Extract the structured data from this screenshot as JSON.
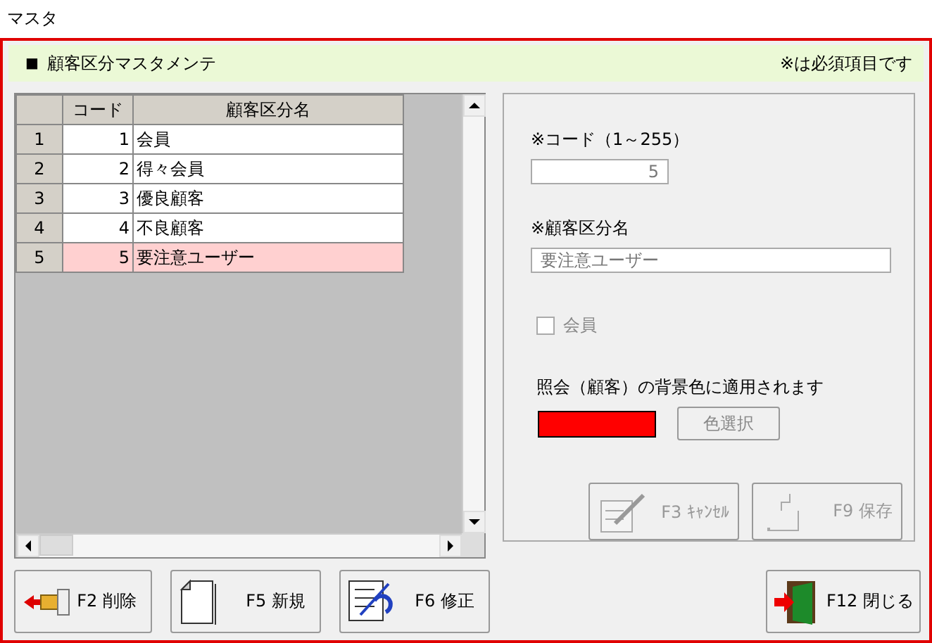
{
  "window": {
    "title": "マスタ"
  },
  "header": {
    "marker": "■",
    "title": "顧客区分マスタメンテ",
    "note": "※は必須項目です"
  },
  "grid": {
    "columns": [
      "コード",
      "顧客区分名"
    ],
    "rows": [
      {
        "number": "1",
        "code": "1",
        "name": "会員",
        "selected": false
      },
      {
        "number": "2",
        "code": "2",
        "name": "得々会員",
        "selected": false
      },
      {
        "number": "3",
        "code": "3",
        "name": "優良顧客",
        "selected": false
      },
      {
        "number": "4",
        "code": "4",
        "name": "不良顧客",
        "selected": false
      },
      {
        "number": "5",
        "code": "5",
        "name": "要注意ユーザー",
        "selected": true
      }
    ]
  },
  "form": {
    "code_label": "※コード（1～255）",
    "code_value": "5",
    "name_label": "※顧客区分名",
    "name_value": "要注意ユーザー",
    "checkbox": {
      "label": "会員",
      "checked": false,
      "disabled": true
    },
    "color_note": "照会（顧客）の背景色に適用されます",
    "color": "#ff0000",
    "color_button": "色選択"
  },
  "action_buttons": [
    {
      "kind": "cancel",
      "label": "F3 ｷｬﾝｾﾙ",
      "disabled": true
    },
    {
      "kind": "save",
      "label": "F9 保存",
      "disabled": true
    }
  ],
  "footer_buttons": [
    {
      "kind": "delete",
      "label": "F2 削除"
    },
    {
      "kind": "new",
      "label": "F5 新規"
    },
    {
      "kind": "edit",
      "label": "F6 修正"
    },
    {
      "kind": "close",
      "label": "F12 閉じる"
    }
  ]
}
